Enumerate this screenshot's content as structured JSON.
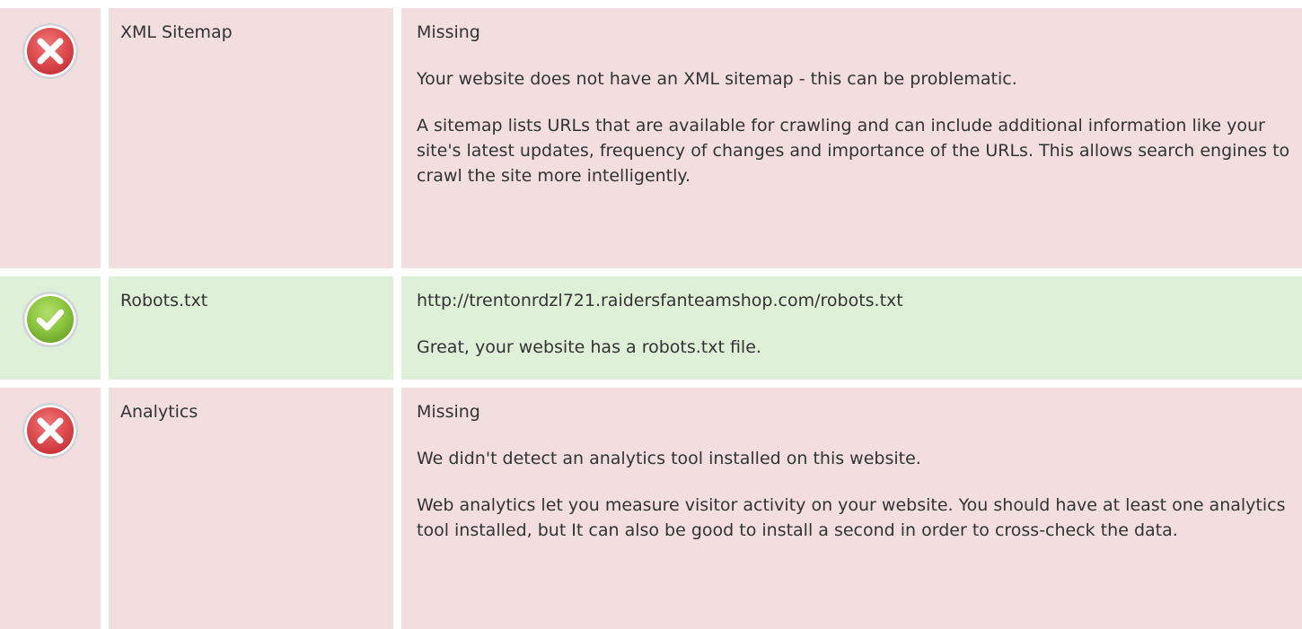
{
  "colors": {
    "error_row_bg": "#f2dede",
    "pass_row_bg": "#dff0d8",
    "error_icon": "#d9534f",
    "pass_icon": "#8cc63f",
    "text": "#333333"
  },
  "rows": [
    {
      "status": "error",
      "icon": "x-circle-icon",
      "name": "XML Sitemap",
      "details": [
        "Missing",
        "Your website does not have an XML sitemap - this can be problematic.",
        "A sitemap lists URLs that are available for crawling and can include additional information like your site's latest updates, frequency of changes and importance of the URLs. This allows search engines to crawl the site more intelligently."
      ]
    },
    {
      "status": "pass",
      "icon": "check-circle-icon",
      "name": "Robots.txt",
      "details": [
        "http://trentonrdzl721.raidersfanteamshop.com/robots.txt",
        "Great, your website has a robots.txt file."
      ]
    },
    {
      "status": "error",
      "icon": "x-circle-icon",
      "name": "Analytics",
      "details": [
        "Missing",
        "We didn't detect an analytics tool installed on this website.",
        "Web analytics let you measure visitor activity on your website. You should have at least one analytics tool installed, but It can also be good to install a second in order to cross-check the data."
      ]
    }
  ]
}
